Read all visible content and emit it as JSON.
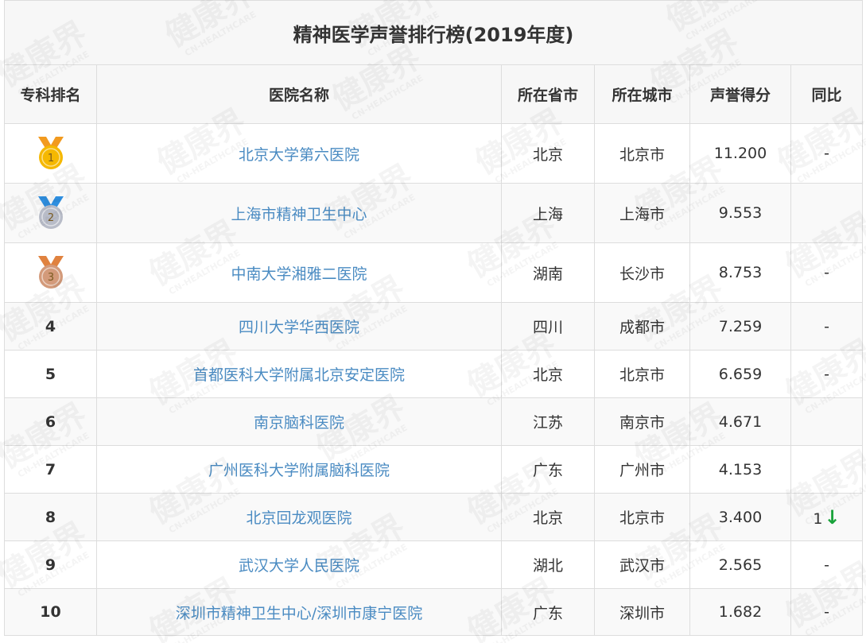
{
  "title": "精神医学声誉排行榜(2019年度)",
  "columns": [
    "专科排名",
    "医院名称",
    "所在省市",
    "所在城市",
    "声誉得分",
    "同比"
  ],
  "rows": [
    {
      "rank": "1",
      "medal": "gold",
      "hospital": "北京大学第六医院",
      "province": "北京",
      "city": "北京市",
      "score": "11.200",
      "yoy": "-"
    },
    {
      "rank": "2",
      "medal": "silver",
      "hospital": "上海市精神卫生中心",
      "province": "上海",
      "city": "上海市",
      "score": "9.553",
      "yoy": ""
    },
    {
      "rank": "3",
      "medal": "bronze",
      "hospital": "中南大学湘雅二医院",
      "province": "湖南",
      "city": "长沙市",
      "score": "8.753",
      "yoy": "-"
    },
    {
      "rank": "4",
      "hospital": "四川大学华西医院",
      "province": "四川",
      "city": "成都市",
      "score": "7.259",
      "yoy": "-"
    },
    {
      "rank": "5",
      "hospital": "首都医科大学附属北京安定医院",
      "province": "北京",
      "city": "北京市",
      "score": "6.659",
      "yoy": "-"
    },
    {
      "rank": "6",
      "hospital": "南京脑科医院",
      "province": "江苏",
      "city": "南京市",
      "score": "4.671",
      "yoy": ""
    },
    {
      "rank": "7",
      "hospital": "广州医科大学附属脑科医院",
      "province": "广东",
      "city": "广州市",
      "score": "4.153",
      "yoy": ""
    },
    {
      "rank": "8",
      "hospital": "北京回龙观医院",
      "province": "北京",
      "city": "北京市",
      "score": "3.400",
      "yoy": "1",
      "trend": "down"
    },
    {
      "rank": "9",
      "hospital": "武汉大学人民医院",
      "province": "湖北",
      "city": "武汉市",
      "score": "2.565",
      "yoy": "-"
    },
    {
      "rank": "10",
      "hospital": "深圳市精神卫生中心/深圳市康宁医院",
      "province": "广东",
      "city": "深圳市",
      "score": "1.682",
      "yoy": "-"
    }
  ],
  "watermark": {
    "text": "健康界",
    "subtext": "CN-HEALTHCARE"
  },
  "colors": {
    "link": "#4a8bc2",
    "header_bg": "#f7f7f7",
    "down_arrow": "#1aa33b",
    "gold": "#f5b800",
    "silver": "#b8bcc8",
    "bronze": "#d39a7a"
  },
  "icons": {
    "trend_down": "down-arrow-icon"
  }
}
